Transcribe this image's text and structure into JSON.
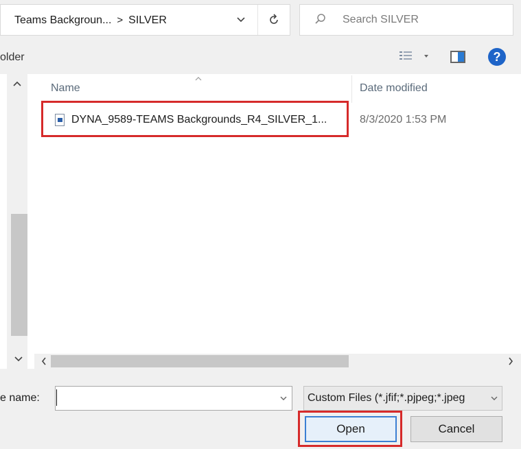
{
  "address_bar": {
    "path": [
      "Teams Backgroun...",
      "SILVER"
    ],
    "separator": ">"
  },
  "search": {
    "placeholder": "Search SILVER"
  },
  "toolbar": {
    "left_label": "older"
  },
  "columns": {
    "name": "Name",
    "date": "Date modified"
  },
  "files": [
    {
      "name": "DYNA_9589-TEAMS Backgrounds_R4_SILVER_1...",
      "date": "8/3/2020 1:53 PM"
    }
  ],
  "footer": {
    "file_name_label": "e name:",
    "file_name_value": "",
    "file_type": "Custom Files (*.jfif;*.pjpeg;*.jpeg",
    "open_label": "Open",
    "cancel_label": "Cancel"
  },
  "icons": {
    "search": "search-icon",
    "refresh": "refresh-icon",
    "dropdown": "chevron-down-icon",
    "view": "view-options-icon",
    "preview": "preview-pane-icon",
    "help": "help-icon",
    "file": "file-icon"
  },
  "colors": {
    "highlight": "#d62a2a",
    "accent": "#1e64c8"
  }
}
